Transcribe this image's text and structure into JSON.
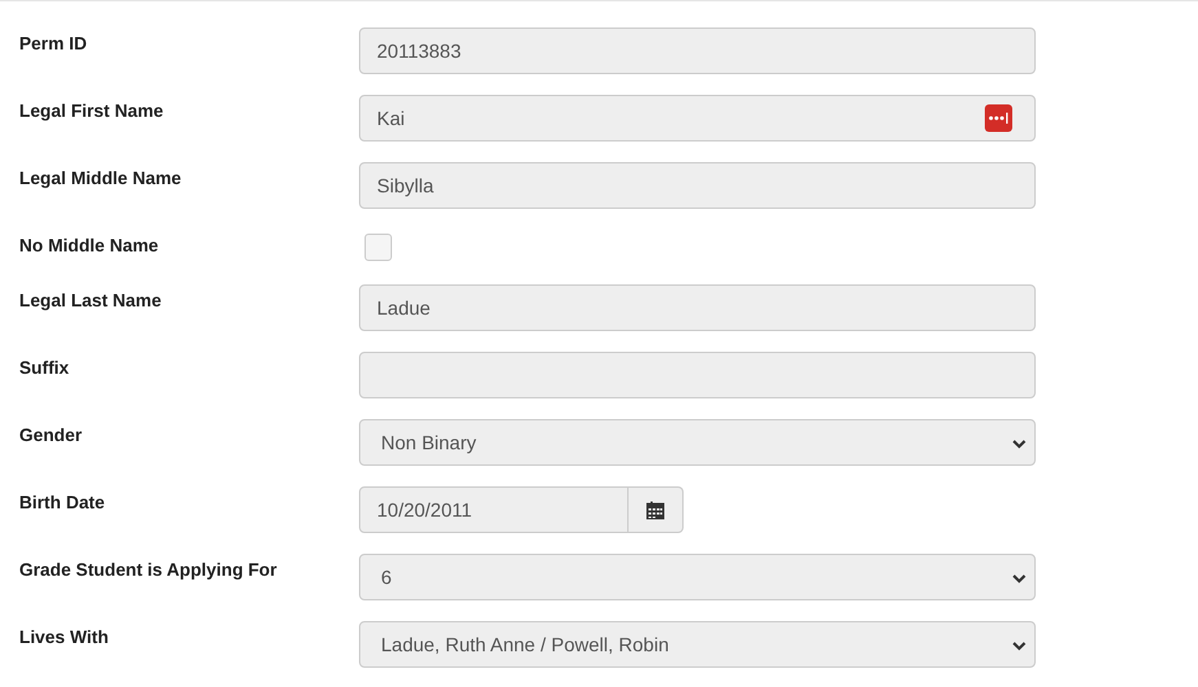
{
  "fields": [
    {
      "kind": "text",
      "label": "Perm ID",
      "value": "20113883"
    },
    {
      "kind": "text",
      "label": "Legal First Name",
      "value": "Kai",
      "has_icon": true
    },
    {
      "kind": "text",
      "label": "Legal Middle Name",
      "value": "Sibylla"
    },
    {
      "kind": "checkbox",
      "label": "No Middle Name",
      "checked": false
    },
    {
      "kind": "text",
      "label": "Legal Last Name",
      "value": "Ladue"
    },
    {
      "kind": "text",
      "label": "Suffix"
    },
    {
      "kind": "select",
      "label": "Gender",
      "value": "Non Binary"
    },
    {
      "kind": "date",
      "label": "Birth Date",
      "value": "10/20/2011"
    },
    {
      "kind": "select",
      "label": "Grade Student is Applying For",
      "value": "6"
    },
    {
      "kind": "select",
      "label": "Lives With",
      "value": "Ladue, Ruth Anne / Powell, Robin"
    }
  ]
}
